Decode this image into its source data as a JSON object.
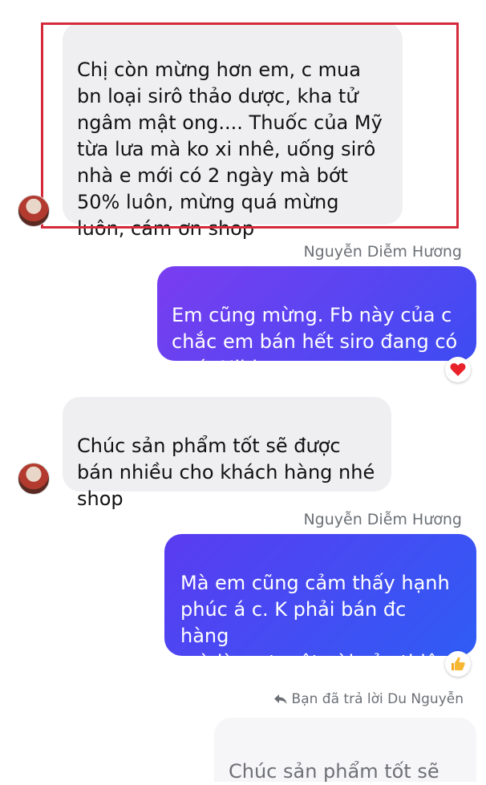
{
  "colors": {
    "incoming_bubble": "#efeff2",
    "outgoing_gradient_1": [
      "#7a3df0",
      "#3d4cf2"
    ],
    "outgoing_gradient_2": [
      "#5a3cf0",
      "#2f5cf5"
    ],
    "highlight": "#d42a3a",
    "sender_name": "#6b6f75"
  },
  "messages": [
    {
      "type": "incoming",
      "text": "Chị còn mừng hơn em, c mua\nbn loại sirô thảo dược, kha tử\nngâm mật ong.... Thuốc của Mỹ\ntừa lưa mà ko xi nhê, uống sirô\nnhà e mới có 2 ngày mà bớt\n50% luôn, mừng quá mừng\nluôn, cám ơn shop",
      "highlighted": true
    },
    {
      "type": "outgoing",
      "sender": "Nguyễn Diễm Hương",
      "text": "Em cũng mừng. Fb này của c\nchắc em bán hết siro đang có\nquá. Hihi",
      "reaction": "heart-icon"
    },
    {
      "type": "incoming",
      "text": "Chúc sản phẩm tốt sẽ được\nbán nhiều cho khách hàng nhé\nshop"
    },
    {
      "type": "outgoing",
      "sender": "Nguyễn Diễm Hương",
      "text": "Mà em cũng cảm thấy hạnh\nphúc á c. K phải bán đc hàng\nmà là sự tuyệt vời của thiên\nnhiên á chị",
      "reaction": "thumbs-up-icon"
    }
  ],
  "reply": {
    "label": "Bạn đã trả lời Du Nguyễn",
    "quoted_text": "Chúc sản phẩm tốt sẽ"
  }
}
